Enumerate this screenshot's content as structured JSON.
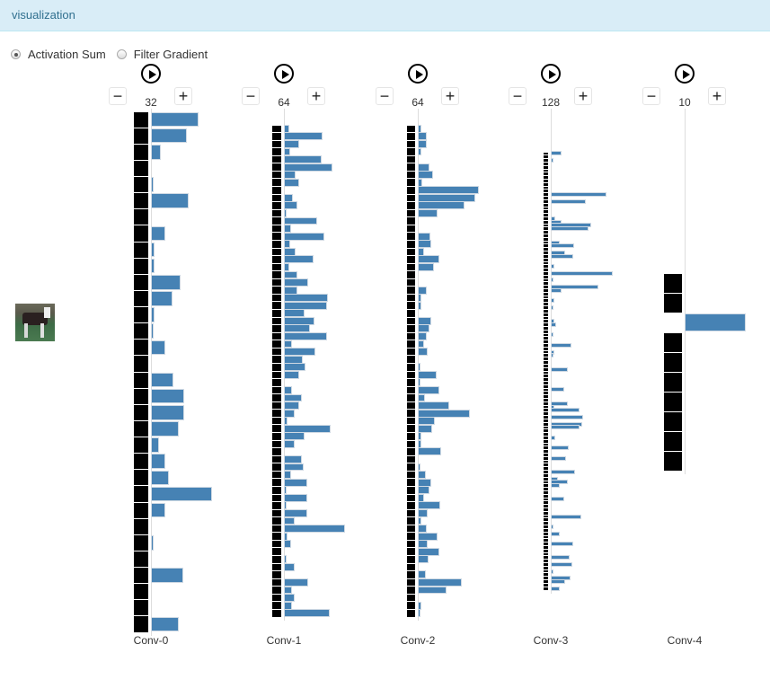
{
  "header": {
    "title": "visualization"
  },
  "mode_options": [
    {
      "label": "Activation Sum",
      "selected": true
    },
    {
      "label": "Filter Gradient",
      "selected": false
    }
  ],
  "input_image": {
    "label": "input-image",
    "description": "horse"
  },
  "colors": {
    "bar": "#4682b4",
    "header_bg": "#d9edf7",
    "header_text": "#31708f"
  },
  "layers": [
    {
      "name": "Conv-0",
      "count": "32",
      "activations": [
        51,
        38,
        9,
        0,
        1,
        40,
        0,
        14,
        2,
        2,
        31,
        22,
        2,
        1,
        14,
        0,
        23,
        35,
        35,
        29,
        7,
        14,
        18,
        66,
        14,
        0,
        1,
        0,
        34,
        0,
        0,
        29
      ],
      "blank_thumbs": []
    },
    {
      "name": "Conv-1",
      "count": "64",
      "activations": [
        4,
        41,
        15,
        5,
        40,
        52,
        11,
        15,
        0,
        8,
        13,
        1,
        35,
        6,
        43,
        5,
        11,
        31,
        4,
        13,
        25,
        13,
        47,
        46,
        21,
        32,
        27,
        46,
        7,
        33,
        19,
        22,
        15,
        0,
        7,
        18,
        15,
        10,
        2,
        50,
        21,
        10,
        0,
        18,
        20,
        6,
        24,
        1,
        24,
        1,
        24,
        10,
        66,
        2,
        6,
        0,
        1,
        10,
        0,
        25,
        7,
        10,
        7,
        49
      ],
      "blank_thumbs": []
    },
    {
      "name": "Conv-2",
      "count": "64",
      "activations": [
        2,
        8,
        8,
        2,
        0,
        11,
        15,
        3,
        66,
        62,
        50,
        20,
        0,
        0,
        12,
        13,
        5,
        22,
        16,
        0,
        0,
        8,
        2,
        2,
        0,
        13,
        11,
        8,
        5,
        9,
        0,
        1,
        19,
        1,
        22,
        6,
        33,
        56,
        17,
        14,
        2,
        2,
        24,
        0,
        1,
        7,
        13,
        11,
        5,
        23,
        9,
        2,
        8,
        20,
        9,
        22,
        10,
        0,
        7,
        47,
        30,
        0,
        2,
        1
      ],
      "blank_thumbs": []
    },
    {
      "name": "Conv-3",
      "count": "128",
      "activations": [
        10,
        0,
        1,
        0,
        0,
        0,
        0,
        0,
        0,
        0,
        0,
        0,
        60,
        0,
        37,
        0,
        0,
        0,
        0,
        3,
        10,
        43,
        40,
        0,
        0,
        0,
        8,
        24,
        0,
        14,
        23,
        0,
        0,
        2,
        0,
        67,
        0,
        1,
        0,
        51,
        10,
        0,
        0,
        2,
        0,
        1,
        0,
        0,
        0,
        2,
        4,
        0,
        0,
        1,
        0,
        0,
        21,
        0,
        2,
        1,
        0,
        0,
        0,
        17,
        0,
        0,
        0,
        0,
        0,
        13,
        0,
        0,
        0,
        17,
        2,
        30,
        0,
        34,
        0,
        33,
        30,
        0,
        0,
        3,
        0,
        0,
        18,
        0,
        0,
        15,
        0,
        0,
        0,
        25,
        0,
        6,
        17,
        8,
        0,
        0,
        0,
        13,
        0,
        0,
        0,
        0,
        32,
        0,
        0,
        1,
        0,
        8,
        0,
        0,
        23,
        0,
        0,
        0,
        19,
        0,
        22,
        0,
        1,
        0,
        20,
        14,
        0,
        8
      ],
      "blank_thumbs": []
    },
    {
      "name": "Conv-4",
      "count": "10",
      "activations": [
        0,
        0,
        66,
        0,
        0,
        0,
        0,
        0,
        0,
        0
      ],
      "blank_thumbs": [
        2
      ]
    }
  ]
}
